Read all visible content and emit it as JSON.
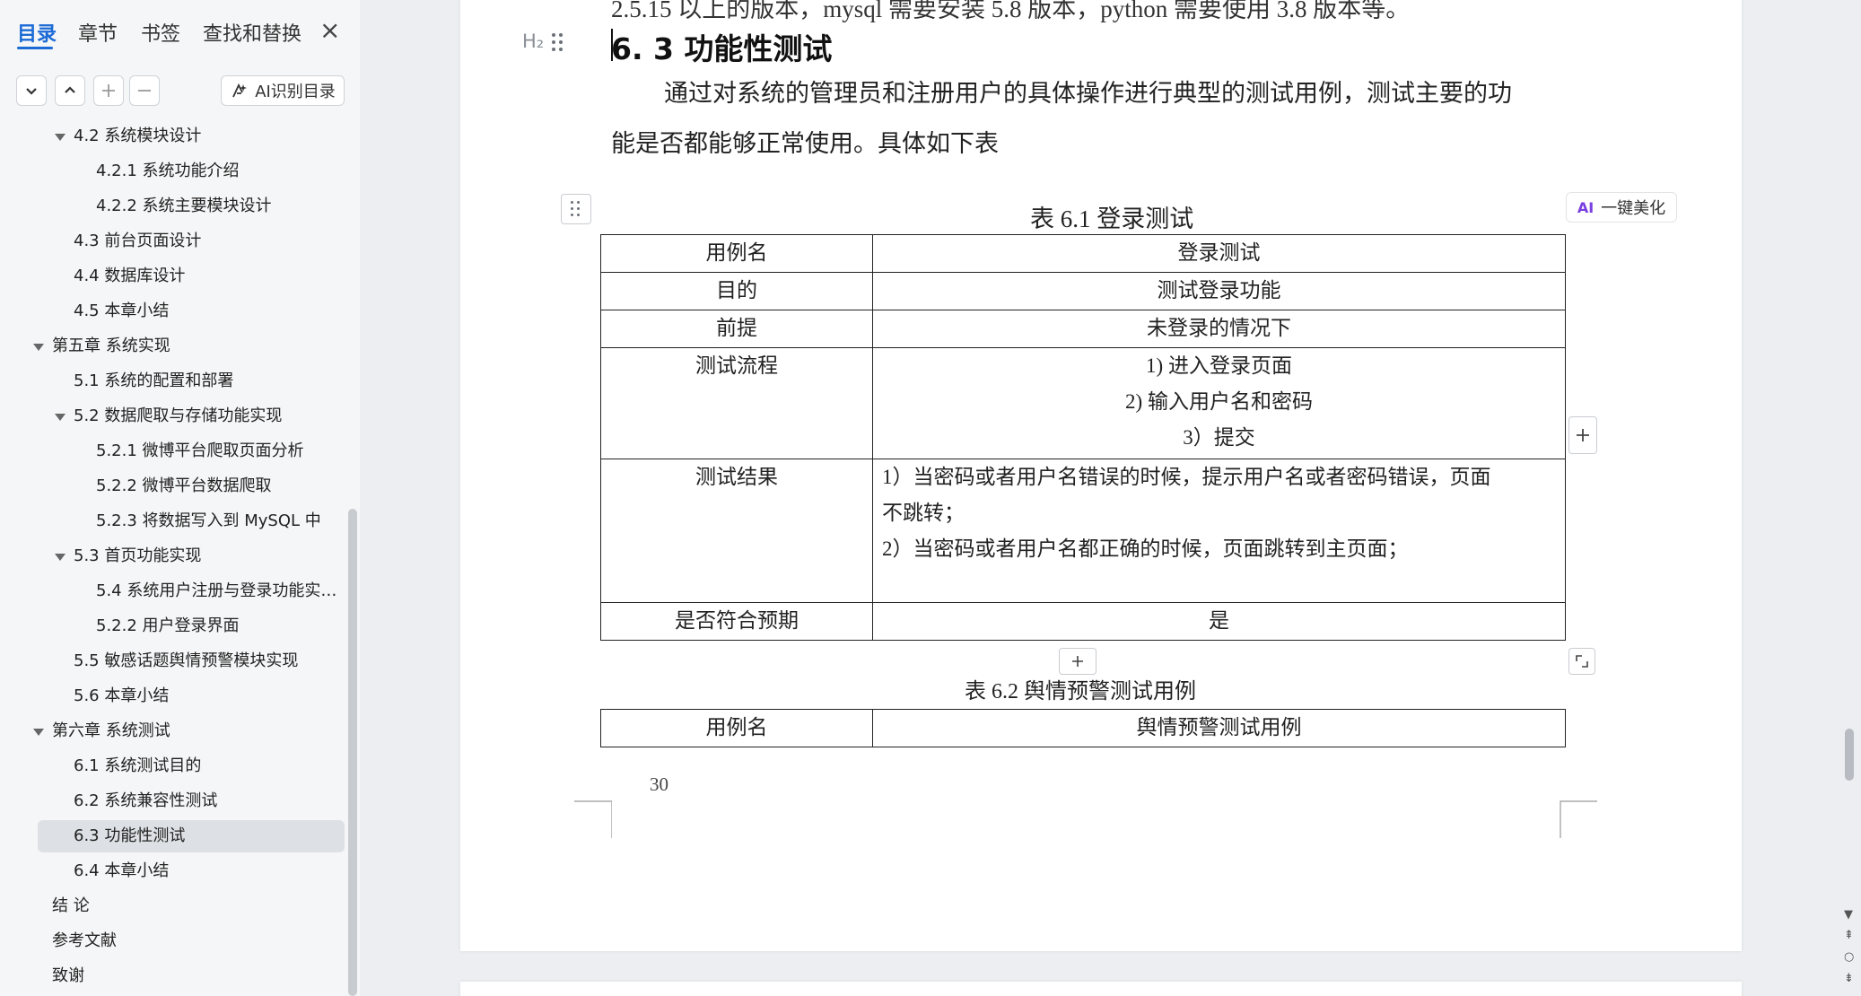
{
  "nav": {
    "tabs": [
      "目录",
      "章节",
      "书签",
      "查找和替换"
    ],
    "active_tab": "目录",
    "ai_toc_label": "AI识别目录",
    "toc_items": [
      {
        "label": "4.2  系统模块设计",
        "level": 2,
        "expanded": true
      },
      {
        "label": "4.2.1 系统功能介绍",
        "level": 3
      },
      {
        "label": "4.2.2 系统主要模块设计",
        "level": 3
      },
      {
        "label": "4.3  前台页面设计",
        "level": 2
      },
      {
        "label": "4.4  数据库设计",
        "level": 2
      },
      {
        "label": "4.5  本章小结",
        "level": 2
      },
      {
        "label": "第五章  系统实现",
        "level": 1,
        "expanded": true
      },
      {
        "label": "5.1  系统的配置和部署",
        "level": 2
      },
      {
        "label": "5.2  数据爬取与存储功能实现",
        "level": 2,
        "expanded": true
      },
      {
        "label": "5.2.1 微博平台爬取页面分析",
        "level": 3
      },
      {
        "label": "5.2.2 微博平台数据爬取",
        "level": 3
      },
      {
        "label": "5.2.3 将数据写入到 MySQL 中",
        "level": 3
      },
      {
        "label": "5.3  首页功能实现",
        "level": 2,
        "expanded": true
      },
      {
        "label": "5.4  系统用户注册与登录功能实…",
        "level": 3
      },
      {
        "label": "5.2.2 用户登录界面",
        "level": 3
      },
      {
        "label": "5.5  敏感话题舆情预警模块实现",
        "level": 2
      },
      {
        "label": "5.6 本章小结",
        "level": 2
      },
      {
        "label": "第六章  系统测试",
        "level": 1,
        "expanded": true
      },
      {
        "label": "6.1  系统测试目的",
        "level": 2
      },
      {
        "label": "6.2  系统兼容性测试",
        "level": 2
      },
      {
        "label": "6.3  功能性测试",
        "level": 2,
        "selected": true
      },
      {
        "label": "6.4  本章小结",
        "level": 2
      },
      {
        "label": "结    论",
        "level": 1
      },
      {
        "label": "参考文献",
        "level": 1
      },
      {
        "label": "致谢",
        "level": 1
      }
    ]
  },
  "doc": {
    "prev_line": "2.5.15 以上的版本，mysql 需要安装 5.8 版本，python 需要使用 3.8 版本等。",
    "h2_marker": "H₂",
    "heading": "6. 3  功能性测试",
    "para_line1": "通过对系统的管理员和注册用户的具体操作进行典型的测试用例，测试主要的功",
    "para_line2": "能是否都能够正常使用。具体如下表",
    "beautify": {
      "badge": "AI",
      "label": "一键美化"
    },
    "table1": {
      "caption": "表 6.1 登录测试",
      "rows": [
        {
          "key": "用例名",
          "value": "登录测试"
        },
        {
          "key": "目的",
          "value": "测试登录功能"
        },
        {
          "key": "前提",
          "value": "未登录的情况下"
        },
        {
          "key": "测试流程",
          "lines": [
            "1)  进入登录页面",
            "2)  输入用户名和密码",
            "3）提交"
          ]
        },
        {
          "key": "测试结果",
          "lines": [
            "1）当密码或者用户名错误的时候，提示用户名或者密码错误，页面",
            "不跳转；",
            "2）当密码或者用户名都正确的时候，页面跳转到主页面；"
          ]
        },
        {
          "key": "是否符合预期",
          "value": "是"
        }
      ]
    },
    "table2": {
      "caption": "表 6.2 舆情预警测试用例",
      "rows": [
        {
          "key": "用例名",
          "value": "舆情预警测试用例"
        }
      ]
    },
    "page_number": "30"
  }
}
